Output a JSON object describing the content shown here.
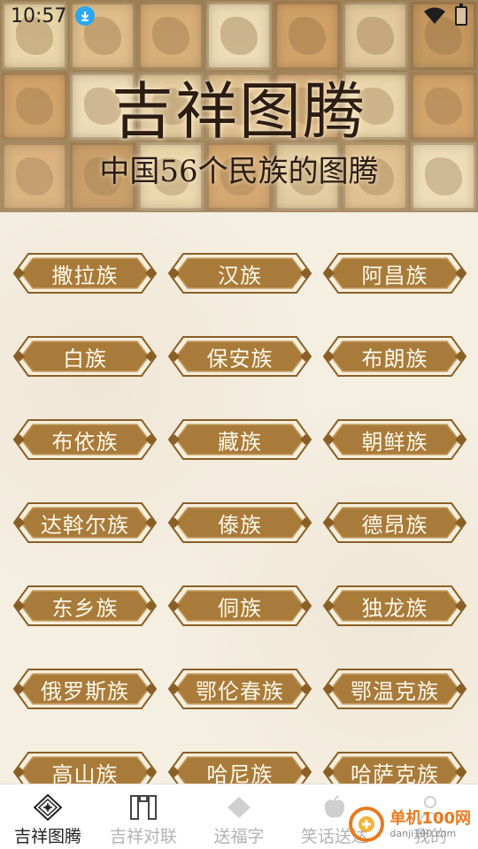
{
  "status_bar": {
    "time": "10:57"
  },
  "hero": {
    "title": "吉祥图腾",
    "subtitle": "中国56个民族的图腾"
  },
  "ethnic_groups": [
    {
      "label": "撒拉族"
    },
    {
      "label": "汉族"
    },
    {
      "label": "阿昌族"
    },
    {
      "label": "白族"
    },
    {
      "label": "保安族"
    },
    {
      "label": "布朗族"
    },
    {
      "label": "布依族"
    },
    {
      "label": "藏族"
    },
    {
      "label": "朝鲜族"
    },
    {
      "label": "达斡尔族"
    },
    {
      "label": "傣族"
    },
    {
      "label": "德昂族"
    },
    {
      "label": "东乡族"
    },
    {
      "label": "侗族"
    },
    {
      "label": "独龙族"
    },
    {
      "label": "俄罗斯族"
    },
    {
      "label": "鄂伦春族"
    },
    {
      "label": "鄂温克族"
    },
    {
      "label": "高山族"
    },
    {
      "label": "哈尼族"
    },
    {
      "label": "哈萨克族"
    }
  ],
  "bottom_nav": {
    "items": [
      {
        "label": "吉祥图腾",
        "icon": "totem-icon",
        "active": true
      },
      {
        "label": "吉祥对联",
        "icon": "couplet-icon",
        "active": false
      },
      {
        "label": "送福字",
        "icon": "diamond-icon",
        "active": false
      },
      {
        "label": "笑话送达",
        "icon": "apple-icon",
        "active": false
      },
      {
        "label": "我的",
        "icon": "person-icon",
        "active": false
      }
    ]
  },
  "watermark": {
    "brand": "单机100网",
    "url": "danji100.com"
  },
  "colors": {
    "button_fill": "#a87b3a",
    "button_border": "#8a5f26",
    "button_text": "#fff8ea",
    "background": "#f5efe2",
    "active_nav": "#222222",
    "inactive_nav": "#b3b3b3"
  }
}
